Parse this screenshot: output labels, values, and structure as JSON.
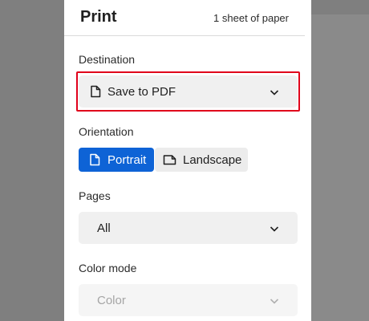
{
  "dialog": {
    "title": "Print",
    "sheet_count": "1 sheet of paper"
  },
  "destination": {
    "label": "Destination",
    "value": "Save to PDF"
  },
  "orientation": {
    "label": "Orientation",
    "options": [
      "Portrait",
      "Landscape"
    ],
    "selected": "Portrait"
  },
  "pages": {
    "label": "Pages",
    "value": "All"
  },
  "color_mode": {
    "label": "Color mode",
    "value": "Color",
    "enabled": false
  },
  "colors": {
    "accent": "#0e63d6",
    "highlight": "#e0001b"
  },
  "icons": [
    "document-icon",
    "chevron-down-icon",
    "landscape-document-icon"
  ]
}
